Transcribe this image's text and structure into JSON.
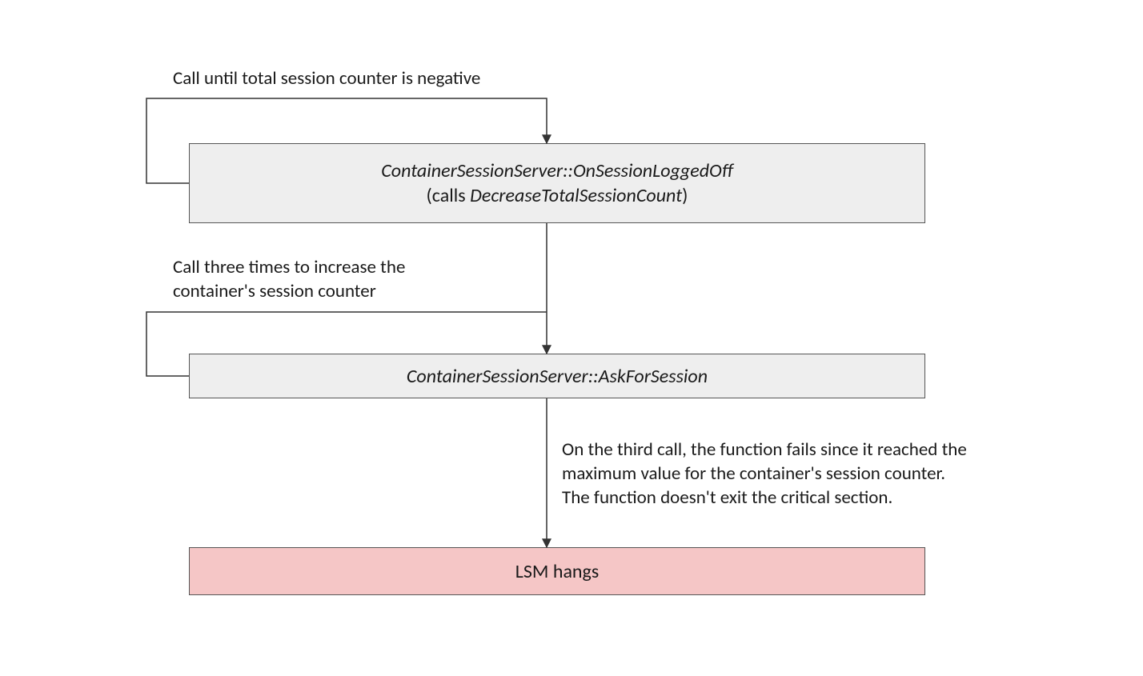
{
  "labels": {
    "top": "Call until total session counter is negative",
    "middle_line1": "Call three times to increase the",
    "middle_line2": "container's session counter",
    "bottom_line1": "On the third call, the function fails since it reached the",
    "bottom_line2": "maximum value for the container's session counter.",
    "bottom_line3": "The function doesn't exit the critical section."
  },
  "boxes": {
    "b1_line1": "ContainerSessionServer::OnSessionLoggedOff",
    "b1_line2_prefix": "(calls ",
    "b1_line2_italic": "DecreaseTotalSessionCount",
    "b1_line2_suffix": ")",
    "b2": "ContainerSessionServer::AskForSession",
    "b3": "LSM hangs"
  }
}
